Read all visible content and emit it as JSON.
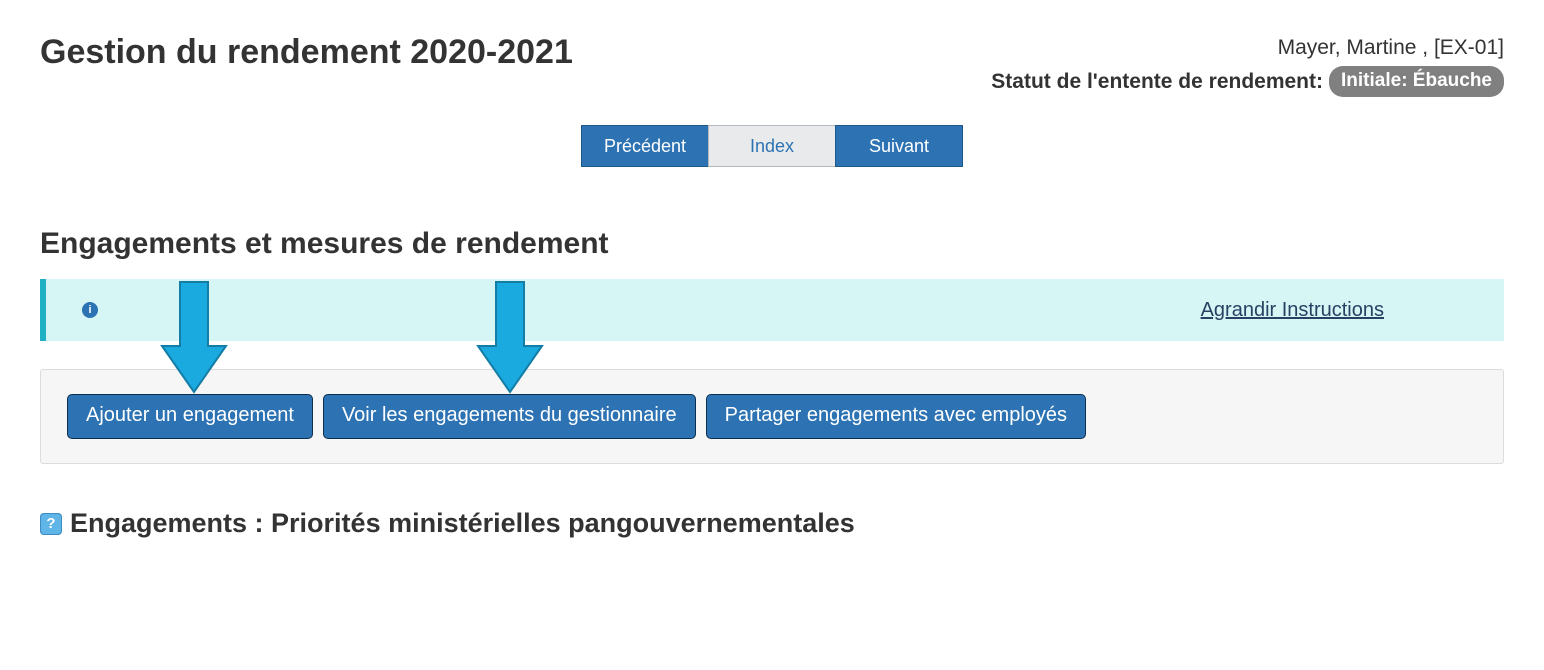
{
  "header": {
    "title": "Gestion du rendement 2020-2021",
    "user_display": "Mayer, Martine , [EX-01]",
    "status_label": "Statut de l'entente de rendement:",
    "status_value": "Initiale: Ébauche"
  },
  "pager": {
    "prev": "Précédent",
    "index": "Index",
    "next": "Suivant"
  },
  "section": {
    "heading": "Engagements et mesures de rendement"
  },
  "info_banner": {
    "expand_label": "Agrandir Instructions"
  },
  "actions": {
    "add_commitment": "Ajouter un engagement",
    "view_manager_commitments": "Voir les engagements du gestionnaire",
    "share_with_employees": "Partager engagements avec employés"
  },
  "subsection": {
    "heading": "Engagements : Priorités ministérielles pangouvernementales"
  },
  "icons": {
    "info": "i",
    "help": "?"
  },
  "accent_arrow_color": "#1aaadf"
}
